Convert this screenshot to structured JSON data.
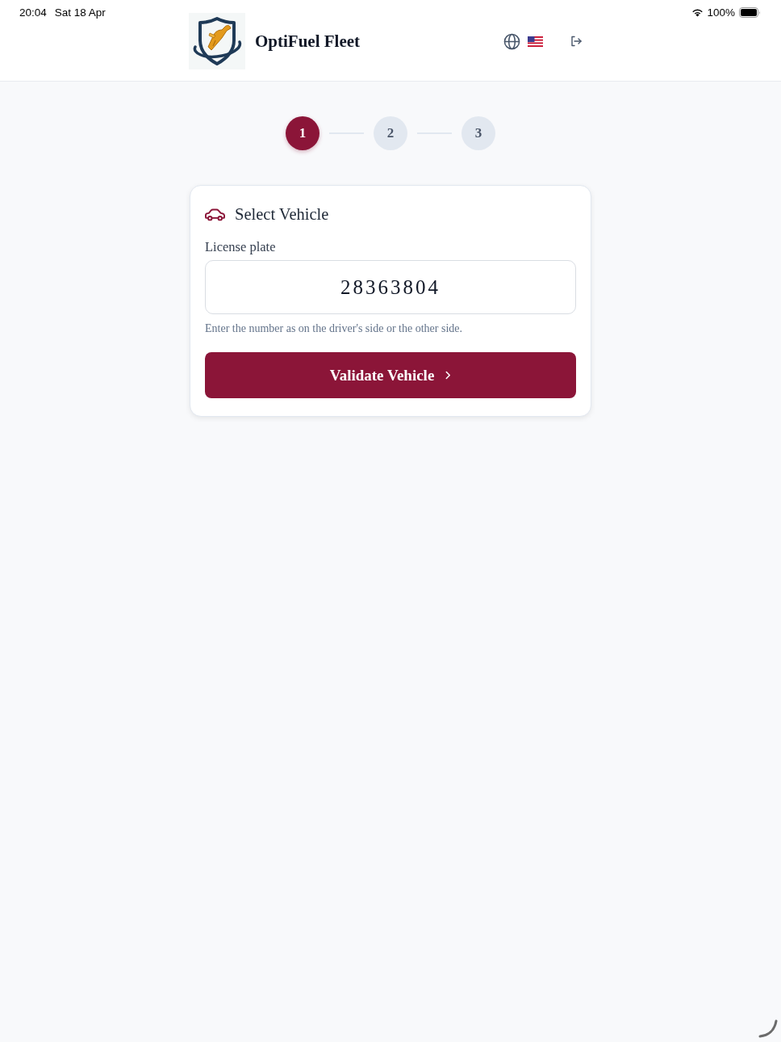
{
  "status_bar": {
    "time": "20:04",
    "date": "Sat 18 Apr",
    "battery": "100%"
  },
  "header": {
    "app_name": "OptiFuel Fleet"
  },
  "stepper": {
    "steps": [
      {
        "label": "1",
        "selected": true
      },
      {
        "label": "2",
        "selected": false
      },
      {
        "label": "3",
        "selected": false
      }
    ]
  },
  "card": {
    "title": "Select Vehicle",
    "field": {
      "label": "License plate",
      "value": "28363804",
      "hint": "Enter the number as on the driver's side or the other side."
    },
    "button": "Validate Vehicle"
  }
}
